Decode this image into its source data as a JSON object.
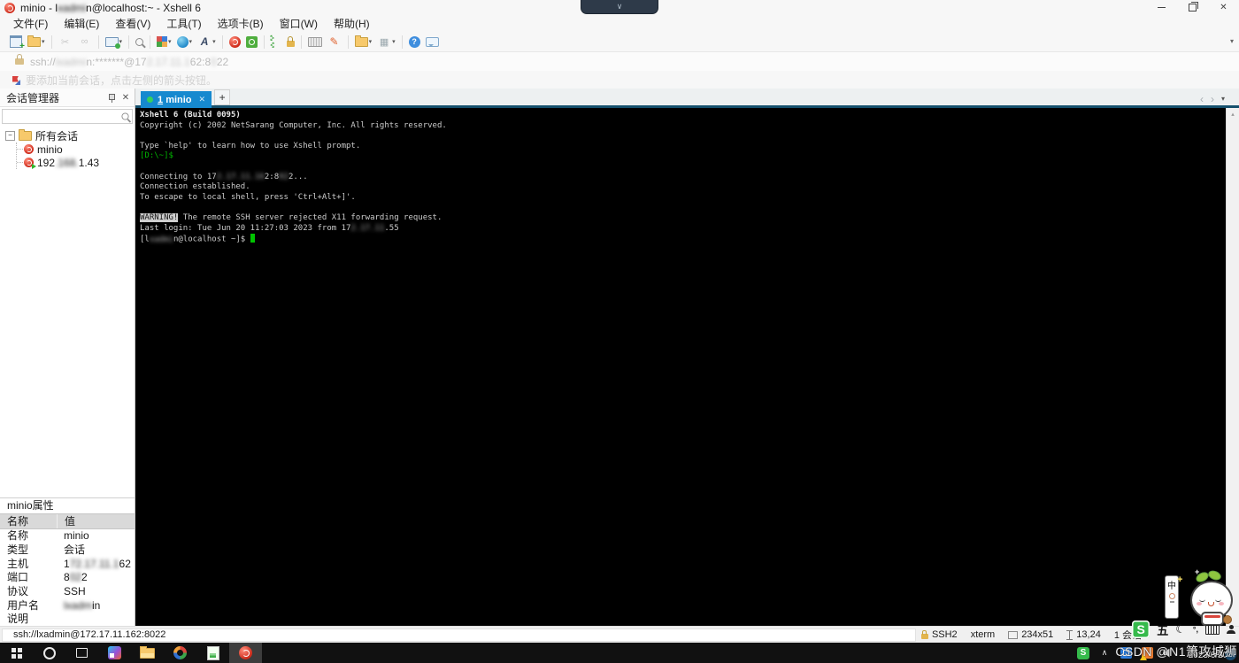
{
  "window": {
    "title_segments": [
      {
        "t": "minio - l"
      },
      {
        "t": "xadmi",
        "bl": 1
      },
      {
        "t": "n@localhost:~ - Xshell 6"
      }
    ],
    "close_glyph": "✕"
  },
  "recorder": {
    "chevron": "∨"
  },
  "menu_items": [
    "文件(F)",
    "编辑(E)",
    "查看(V)",
    "工具(T)",
    "选项卡(B)",
    "窗口(W)",
    "帮助(H)"
  ],
  "toolbar": [
    {
      "n": "new-session",
      "cls": "I-new"
    },
    {
      "n": "open-session",
      "cls": "fold",
      "dd": 1
    },
    {
      "sep": 1
    },
    {
      "n": "disconnect",
      "cls": "I-g",
      "g": "✂",
      "dis": 1
    },
    {
      "n": "reconnect",
      "cls": "I-g",
      "g": "∞",
      "dis": 1
    },
    {
      "sep": 1
    },
    {
      "n": "session-properties",
      "cls": "I-mon",
      "dd": 1
    },
    {
      "sep": 1
    },
    {
      "n": "find",
      "cls": "I-mag"
    },
    {
      "sep": 1
    },
    {
      "n": "color-scheme",
      "cls": "I-pal",
      "dd": 1
    },
    {
      "n": "encoding",
      "cls": "I-globe",
      "dd": 1
    },
    {
      "n": "font",
      "cls": "I-fontA",
      "g": "A",
      "dd": 1
    },
    {
      "sep": 1
    },
    {
      "n": "xshell",
      "cls": "I-ball"
    },
    {
      "n": "xftp",
      "cls": "I-xftp"
    },
    {
      "sep": 1
    },
    {
      "n": "fullscreen",
      "cls": "I-fs"
    },
    {
      "n": "lock-screen",
      "cls": "I-lock"
    },
    {
      "sep": 1
    },
    {
      "n": "virtual-keyboard",
      "cls": "I-kbd"
    },
    {
      "n": "highlighter",
      "cls": "I-pen",
      "g": "✎"
    },
    {
      "sep": 1
    },
    {
      "n": "new-folder",
      "cls": "fold",
      "dd": 1
    },
    {
      "n": "transparency",
      "cls": "I-tr",
      "g": "▦",
      "dd": 1
    },
    {
      "sep": 1
    },
    {
      "n": "help",
      "cls": "I-hlp",
      "g": "?"
    },
    {
      "n": "feedback",
      "cls": "I-bub"
    }
  ],
  "toolbar_overflow_glyph": "▾",
  "addressbar": {
    "segments": [
      {
        "t": "ssh://"
      },
      {
        "t": "lxadmi",
        "bl": 1
      },
      {
        "t": "n:*******@17"
      },
      {
        "t": "2.17.11.1",
        "bl": 1
      },
      {
        "t": "62:8"
      },
      {
        "t": "0",
        "bl": 1
      },
      {
        "t": "22"
      }
    ]
  },
  "notice": {
    "text": "要添加当前会话，点击左侧的箭头按钮。"
  },
  "session_manager": {
    "title": "会话管理器",
    "close_glyph": "✕",
    "collapse_glyph": "−",
    "root_label": "所有会话",
    "sessions": [
      {
        "icon": "xshell-session-icon",
        "conn": 0,
        "segs": [
          {
            "t": "minio"
          }
        ]
      },
      {
        "icon": "xshell-session-connected-icon",
        "conn": 1,
        "segs": [
          {
            "t": "192"
          },
          {
            "t": ".168.",
            "bl": 1
          },
          {
            "t": "1.43"
          }
        ]
      }
    ]
  },
  "tabbar": {
    "active": {
      "num": "1",
      "name": "minio"
    },
    "close_glyph": "✕",
    "new_tab_glyph": "+",
    "nav_left": "‹",
    "nav_right": "›",
    "nav_menu": "▾"
  },
  "terminal": {
    "lines": [
      [
        {
          "t": "Xshell 6 (Build 0095)",
          "b": 1
        }
      ],
      [
        {
          "t": "Copyright (c) 2002 NetSarang Computer, Inc. All rights reserved."
        }
      ],
      [],
      [
        {
          "t": "Type `help' to learn how to use Xshell prompt."
        }
      ],
      [
        {
          "t": "[D:\\~]$",
          "c": 1
        }
      ],
      [],
      [
        {
          "t": "Connecting to 17"
        },
        {
          "t": "2.17.11.16",
          "bl": 1
        },
        {
          "t": "2:8"
        },
        {
          "t": "02",
          "bl": 1
        },
        {
          "t": "2..."
        }
      ],
      [
        {
          "t": "Connection established."
        }
      ],
      [
        {
          "t": "To escape to local shell, press 'Ctrl+Alt+]'."
        }
      ],
      [],
      [
        {
          "t": "WARNING!",
          "inv": 1
        },
        {
          "t": " The remote SSH server rejected X11 forwarding request."
        }
      ],
      [
        {
          "t": "Last login: Tue Jun 20 11:27:03 2023 from 17"
        },
        {
          "t": "2.17.11",
          "bl": 1
        },
        {
          "t": ".55"
        }
      ],
      [
        {
          "t": "[l"
        },
        {
          "t": "xadmi",
          "bl": 1
        },
        {
          "t": "n@localhost ~]$ "
        },
        {
          "t": " ",
          "cur": 1
        }
      ]
    ],
    "scroll_up_glyph": "▴"
  },
  "properties": {
    "title": "minio属性",
    "header": {
      "name": "名称",
      "value": "值"
    },
    "rows": [
      {
        "name": "名称",
        "value": [
          {
            "t": "minio"
          }
        ]
      },
      {
        "name": "类型",
        "value": [
          {
            "t": "会话"
          }
        ]
      },
      {
        "name": "主机",
        "value": [
          {
            "t": "1"
          },
          {
            "t": "72.17.11.1",
            "bl": 1
          },
          {
            "t": "62"
          }
        ]
      },
      {
        "name": "端口",
        "value": [
          {
            "t": "8"
          },
          {
            "t": "02",
            "bl": 1
          },
          {
            "t": "2"
          }
        ]
      },
      {
        "name": "协议",
        "value": [
          {
            "t": "SSH"
          }
        ]
      },
      {
        "name": "用户名",
        "value": [
          {
            "t": "lxadm",
            "bl": 1
          },
          {
            "t": "in"
          }
        ]
      },
      {
        "name": "说明",
        "value": []
      }
    ]
  },
  "statusbar": {
    "left": "ssh://lxadmin@172.17.11.162:8022",
    "items": [
      {
        "ic": "S-lock",
        "icn": "lock-icon",
        "t": "SSH2"
      },
      {
        "t": "xterm"
      },
      {
        "ic": "S-dim",
        "icn": "terminal-size-icon",
        "t": "234x51"
      },
      {
        "ic": "S-pos",
        "icn": "cursor-position-icon",
        "t": "13,24"
      },
      {
        "t": "1 会话"
      }
    ]
  },
  "taskbar": {
    "items": [
      {
        "n": "start",
        "cls": "K-win"
      },
      {
        "n": "cortana-search",
        "cls": "K-ring"
      },
      {
        "n": "task-view",
        "cls": "K-tv"
      },
      {
        "n": "datagrip",
        "cls": "K-dg"
      },
      {
        "n": "file-explorer",
        "cls": "K-fe"
      },
      {
        "n": "navicat",
        "cls": "K-nv"
      },
      {
        "n": "notes-app",
        "cls": "K-np"
      },
      {
        "n": "xshell",
        "cls": "K-ball",
        "active": 1
      }
    ],
    "tray": [
      {
        "n": "sogou-tray",
        "cls": "K-sg",
        "g": "S"
      },
      {
        "n": "hidden-icons",
        "cls": "K-up",
        "g": "∧"
      },
      {
        "n": "tray-app-blue",
        "cls": "K-tb1"
      },
      {
        "n": "tray-app-orange",
        "cls": "K-tb2"
      },
      {
        "n": "volume",
        "cls": "K-vol"
      }
    ],
    "clock_date": "2023/6/20",
    "notification_badge": "3"
  },
  "ime": {
    "logo": "S",
    "mode": "五",
    "moon": "☾",
    "punct": "°,"
  },
  "mascot": {
    "pill_char": "中",
    "sparkle1": "+",
    "sparkle2": "+"
  },
  "watermark": "CSDN @N1箫攻城狮",
  "colors": {
    "active_tab": "#1689cf",
    "terminal_green": "#00b300",
    "session_icon_red": "#cf2c1b",
    "sogou_green": "#35ba4b",
    "taskbar": "#111111"
  }
}
